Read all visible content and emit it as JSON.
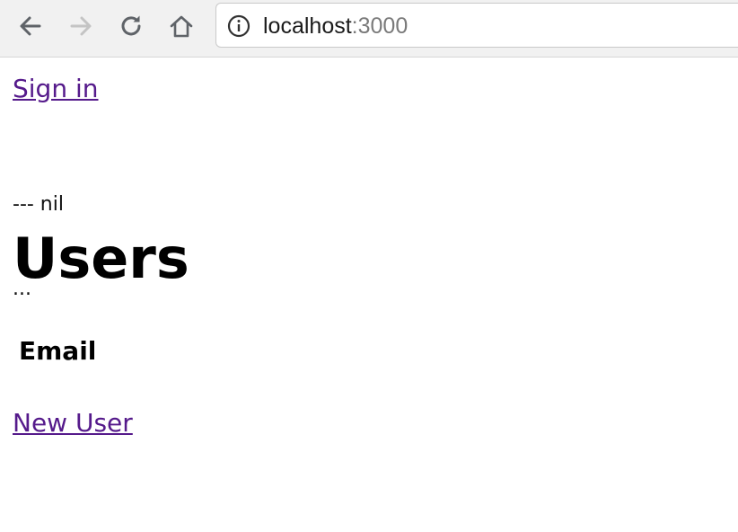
{
  "browser": {
    "url_host": "localhost",
    "url_port": ":3000"
  },
  "page": {
    "sign_in_link": "Sign in",
    "debug_line_1": "--- nil",
    "debug_line_2": "...",
    "title": "Users",
    "table": {
      "headers": [
        "Email"
      ],
      "rows": []
    },
    "new_user_link": "New User"
  },
  "colors": {
    "link_visited": "#551a8b",
    "toolbar_bg": "#f1f1f1"
  },
  "icons": {
    "back": "arrow-left-icon",
    "forward": "arrow-right-icon",
    "reload": "reload-icon",
    "home": "home-icon",
    "info": "info-icon"
  }
}
